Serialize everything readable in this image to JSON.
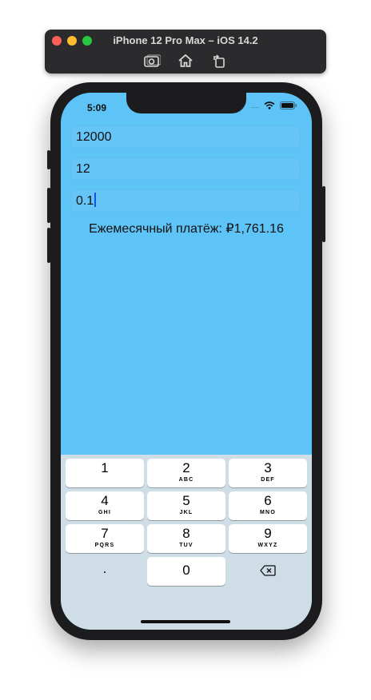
{
  "window": {
    "title": "iPhone 12 Pro Max – iOS 14.2",
    "toolbar_icons": [
      "screenshot-icon",
      "home-icon",
      "rotate-icon"
    ]
  },
  "status_bar": {
    "time": "5:09",
    "signal": "....",
    "icons": [
      "wifi-icon",
      "battery-icon"
    ]
  },
  "form": {
    "amount": "12000",
    "months": "12",
    "rate": "0.1"
  },
  "result_text": "Ежемесячный платёж: ₽1,761.16",
  "colors": {
    "screen_background": "#5ec3f6",
    "keypad_background": "#cfdde7"
  },
  "keypad": {
    "keys": [
      {
        "digit": "1",
        "letters": ""
      },
      {
        "digit": "2",
        "letters": "ABC"
      },
      {
        "digit": "3",
        "letters": "DEF"
      },
      {
        "digit": "4",
        "letters": "GHI"
      },
      {
        "digit": "5",
        "letters": "JKL"
      },
      {
        "digit": "6",
        "letters": "MNO"
      },
      {
        "digit": "7",
        "letters": "PQRS"
      },
      {
        "digit": "8",
        "letters": "TUV"
      },
      {
        "digit": "9",
        "letters": "WXYZ"
      }
    ],
    "decimal": ".",
    "zero": "0",
    "delete_icon": "backspace-icon"
  }
}
